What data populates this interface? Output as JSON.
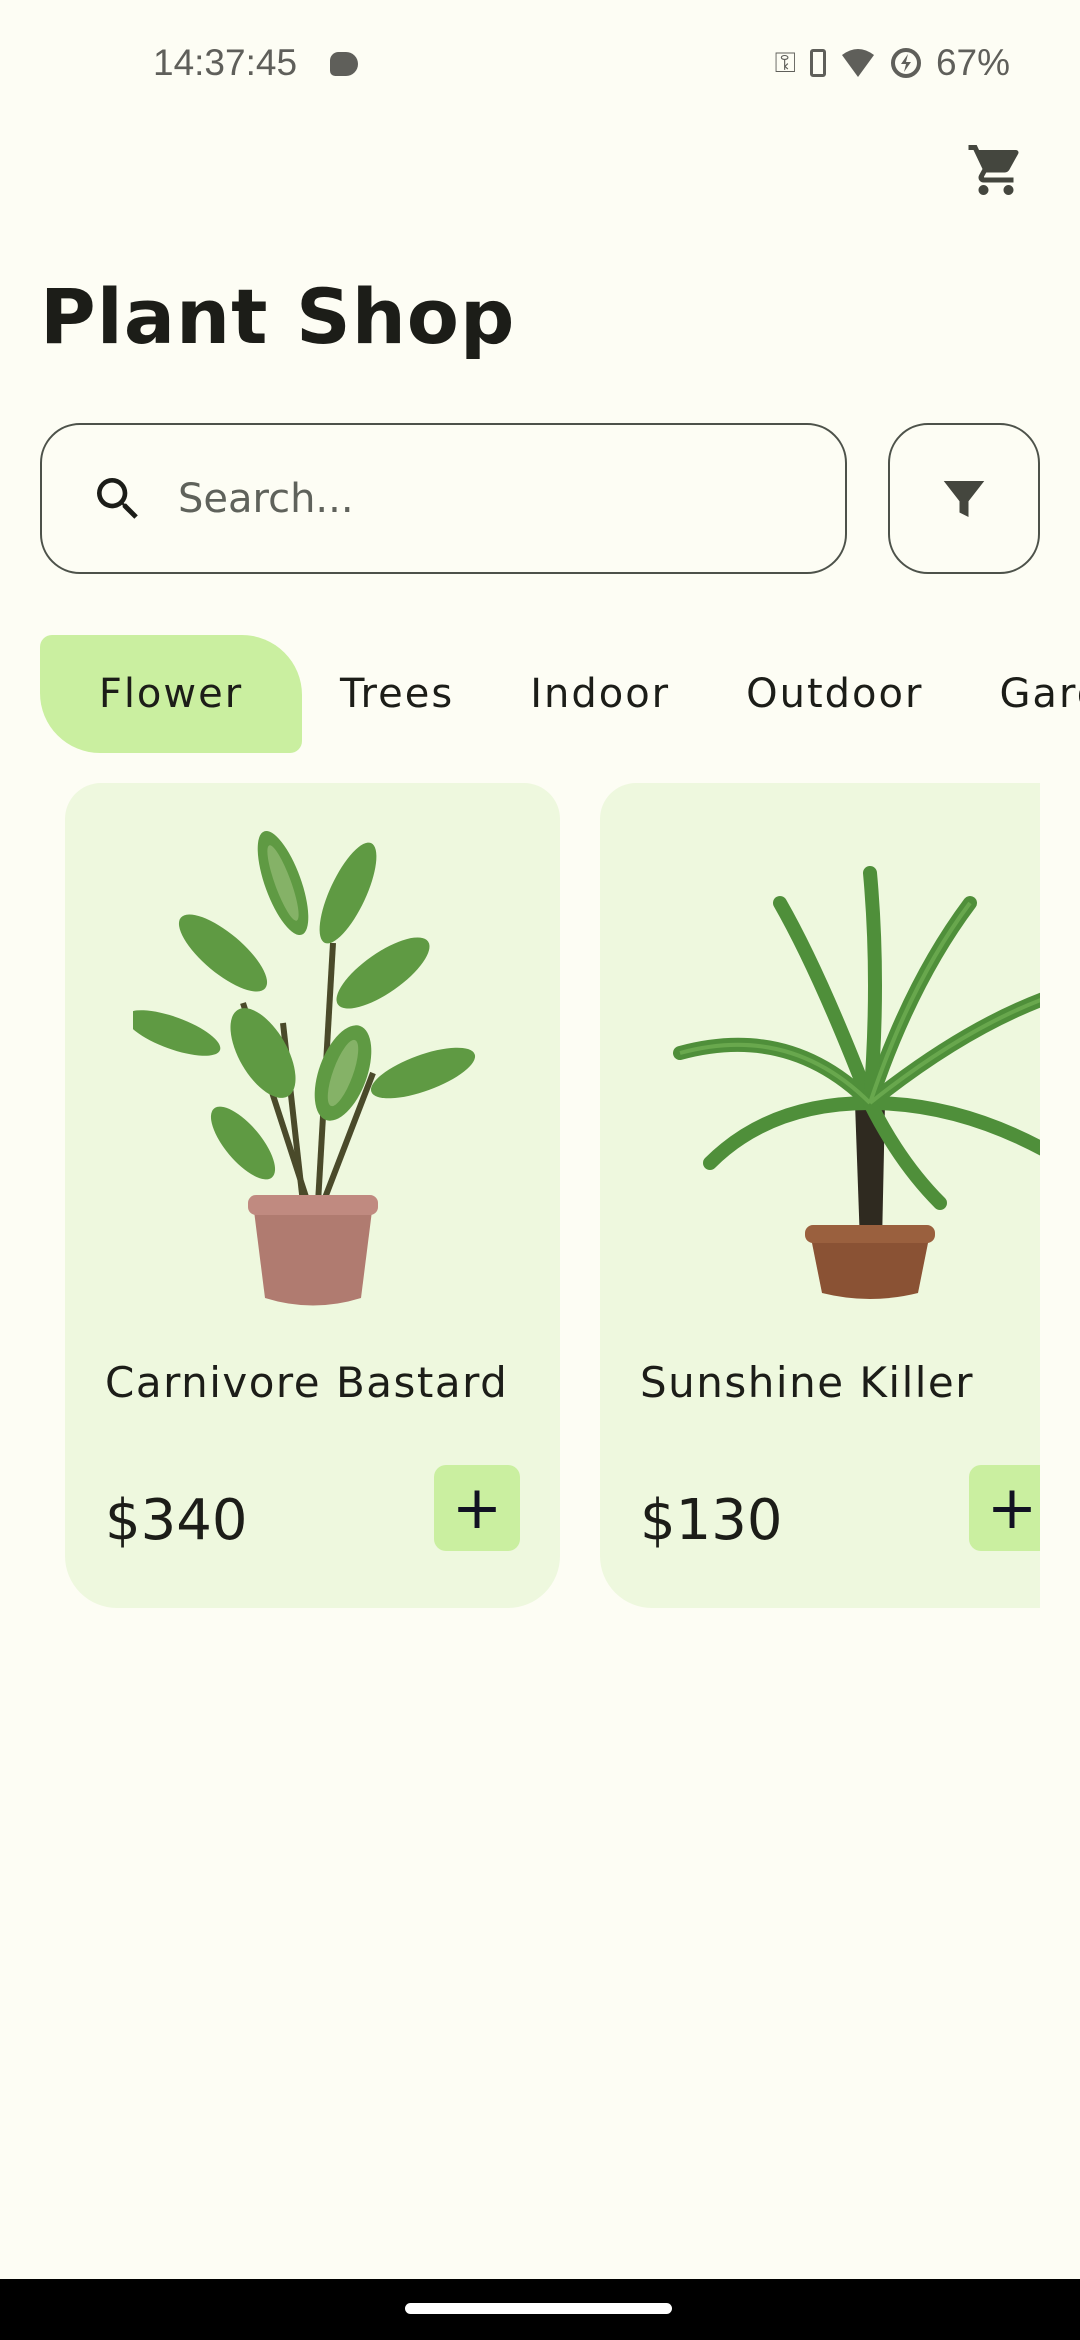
{
  "status_bar": {
    "time": "14:37:45",
    "battery": "67%"
  },
  "header": {
    "title_bold": "Plant",
    "title_regular": "Shop"
  },
  "search": {
    "placeholder": "Search..."
  },
  "categories": [
    "Flower",
    "Trees",
    "Indoor",
    "Outdoor",
    "Garden"
  ],
  "active_category": "Flower",
  "products": [
    {
      "name": "Carnivore Bastard",
      "price": "$340",
      "add_label": "+"
    },
    {
      "name": "Sunshine Killer",
      "price": "$130",
      "add_label": "+"
    }
  ],
  "colors": {
    "background": "#fdfdf4",
    "accent": "#caefa0",
    "card": "#eef8de"
  }
}
